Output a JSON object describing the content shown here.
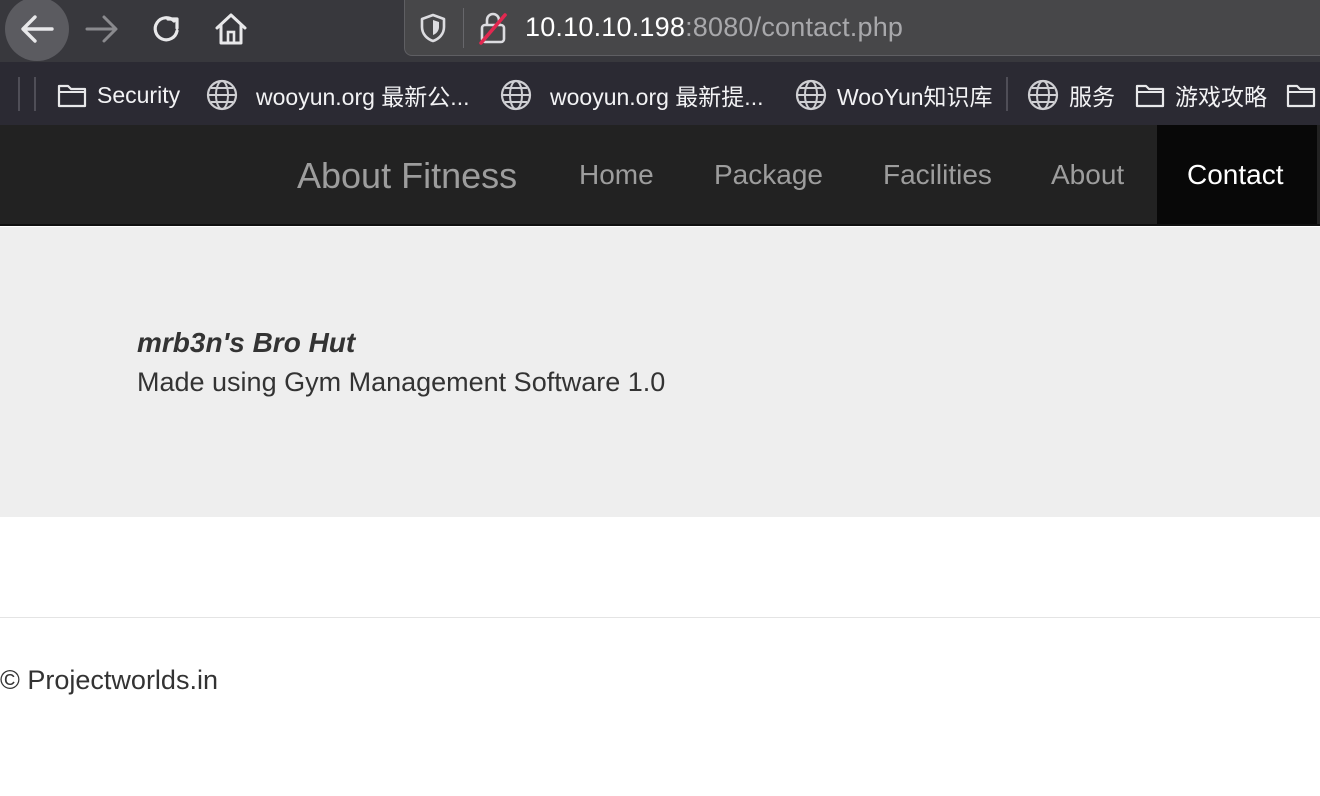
{
  "browser": {
    "url_host": "10.10.10.198",
    "url_rest": ":8080/contact.php",
    "colors": {
      "chrome": "#38383d",
      "urlbar": "#474749",
      "bookmarks": "#2b2a33",
      "insecure_strike": "#e22850"
    },
    "bookmarks": [
      {
        "label": "Security",
        "icon": "folder-icon"
      },
      {
        "label": "wooyun.org 最新公...",
        "icon": "globe-icon"
      },
      {
        "label": "wooyun.org 最新提...",
        "icon": "globe-icon"
      },
      {
        "label": "WooYun知识库",
        "icon": "globe-icon"
      },
      {
        "label": "服务",
        "icon": "globe-icon"
      },
      {
        "label": "游戏攻略",
        "icon": "folder-icon"
      }
    ]
  },
  "site": {
    "brand": "About Fitness",
    "nav": [
      {
        "label": "Home",
        "active": false
      },
      {
        "label": "Package",
        "active": false
      },
      {
        "label": "Facilities",
        "active": false
      },
      {
        "label": "About",
        "active": false
      },
      {
        "label": "Contact",
        "active": true
      }
    ],
    "jumbotron": {
      "title": "mrb3n's Bro Hut",
      "subtitle": "Made using Gym Management Software 1.0"
    },
    "footer": "© Projectworlds.in",
    "colors": {
      "navbar": "#222222",
      "active_nav": "#080808",
      "jumbotron": "#eeeeee",
      "text": "#333333"
    }
  }
}
